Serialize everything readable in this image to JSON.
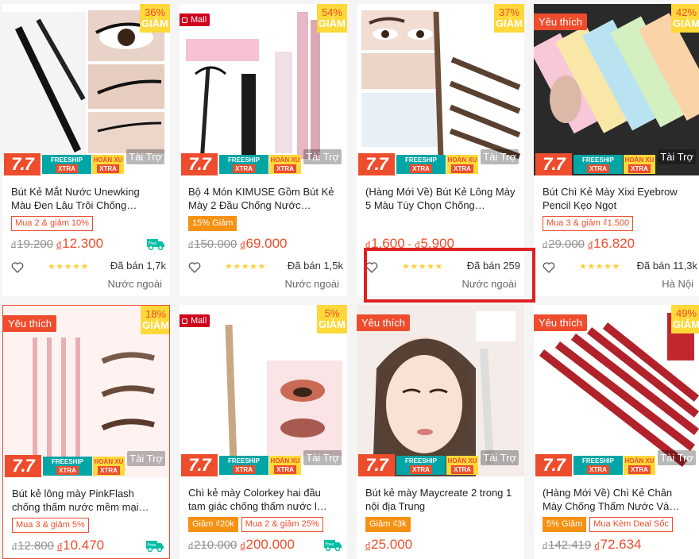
{
  "labels": {
    "ad": "Tài Trợ",
    "discount_word": "GIẢM",
    "mall": "Mall",
    "favorite": "Yêu thích",
    "seven_seven": "7.7",
    "freeship": "FREESHIP",
    "xtra": "XTRA",
    "hoan_xu": "HOÀN XU",
    "currency": "đ",
    "free": "Free"
  },
  "colors": {
    "accent": "#ee4d2d",
    "discount_bg": "#ffd839",
    "star": "#ffce3d",
    "highlight": "#e02020"
  },
  "products": [
    {
      "name": "Bút Kẻ Mắt Nước Unewking Màu Đen Lâu Trôi Chống…",
      "discount": "36%",
      "tag": "",
      "chips": [
        {
          "text": "Mua 2 & giảm 10%",
          "style": "outline"
        }
      ],
      "old_price": "19.200",
      "price": "12.300",
      "price_max": "",
      "freeship_icon": true,
      "stars": "★★★★★",
      "sold": "Đã bán 1,7k",
      "location": "Nước ngoài"
    },
    {
      "name": "Bộ 4 Món KIMUSE Gồm Bút Kẻ Mày 2 Đầu Chống Nước…",
      "discount": "54%",
      "tag": "mall",
      "chips": [
        {
          "text": "15% Giảm",
          "style": "solid"
        }
      ],
      "old_price": "150.000",
      "price": "69.000",
      "price_max": "",
      "freeship_icon": false,
      "stars": "★★★★★",
      "sold": "Đã bán 1,5k",
      "location": "Nước ngoài"
    },
    {
      "name": "(Hàng Mới Về) Bút Kẻ Lông Mày 5 Màu Tùy Chọn Chống…",
      "discount": "37%",
      "tag": "",
      "chips": [],
      "old_price": "",
      "price": "1.600",
      "price_max": "5.900",
      "freeship_icon": false,
      "stars": "★★★★★",
      "sold": "Đã bán 259",
      "location": "Nước ngoài"
    },
    {
      "name": "Bút Chì Kẻ Mày Xixi Eyebrow Pencil Kẹo Ngọt",
      "discount": "42%",
      "tag": "fav",
      "chips": [
        {
          "text": "Mua 3 & giảm ₫1.500",
          "style": "outline"
        }
      ],
      "old_price": "29.000",
      "price": "16.820",
      "price_max": "",
      "freeship_icon": false,
      "stars": "★★★★★",
      "sold": "Đã bán 11,3k",
      "location": "Hà Nội"
    },
    {
      "name": "Bút kẻ lông mày PinkFlash chống thấm nước mềm mại…",
      "discount": "18%",
      "tag": "fav",
      "chips": [
        {
          "text": "Mua 3 & giảm 5%",
          "style": "outline"
        }
      ],
      "old_price": "12.800",
      "price": "10.470",
      "price_max": "",
      "freeship_icon": true,
      "stars": "",
      "sold": "",
      "location": ""
    },
    {
      "name": "Chì kẻ mày Colorkey hai đầu tam giác chống thấm nước l…",
      "discount": "5%",
      "tag": "mall",
      "chips": [
        {
          "text": "Giảm ₫20k",
          "style": "solid"
        },
        {
          "text": "Mua 2 & giảm 25%",
          "style": "outline"
        }
      ],
      "old_price": "210.000",
      "price": "200.000",
      "price_max": "",
      "freeship_icon": true,
      "stars": "",
      "sold": "",
      "location": ""
    },
    {
      "name": "Bút kẻ mày Maycreate 2 trong 1 nội địa Trung",
      "discount": "",
      "tag": "fav",
      "chips": [
        {
          "text": "Giảm ₫3k",
          "style": "solid"
        }
      ],
      "old_price": "",
      "price": "25.000",
      "price_max": "",
      "freeship_icon": false,
      "stars": "",
      "sold": "",
      "location": ""
    },
    {
      "name": "(Hàng Mới Về) Chì Kẻ Chân Mày Chống Thấm Nước Và…",
      "discount": "49%",
      "tag": "fav",
      "chips": [
        {
          "text": "5% Giảm",
          "style": "solid"
        },
        {
          "text": "Mua Kèm Deal Sốc",
          "style": "outline"
        }
      ],
      "old_price": "142.419",
      "price": "72.634",
      "price_max": "",
      "freeship_icon": false,
      "stars": "",
      "sold": "",
      "location": ""
    }
  ]
}
